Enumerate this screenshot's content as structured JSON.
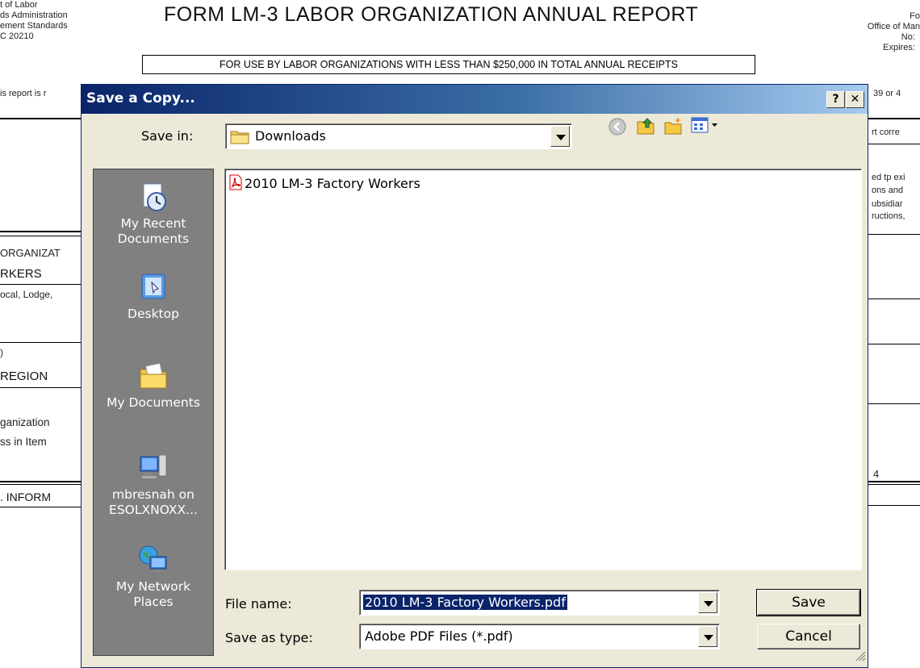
{
  "background": {
    "left_header": "t of Labor\nds Administration\nement Standards\nC 20210",
    "title": "FORM LM-3 LABOR ORGANIZATION ANNUAL REPORT",
    "subtitle": "FOR USE BY LABOR ORGANIZATIONS WITH LESS THAN $250,000 IN TOTAL ANNUAL RECEIPTS",
    "right_header": "Fo\nOffice of Man\nNo:  \nExpires:  ",
    "left_note": "is report is r",
    "right_note": "39 or 4",
    "left_fragments": [
      "ORGANIZAT",
      "RKERS",
      "ocal, Lodge,",
      ")",
      "REGION",
      "ganization",
      "ss in Item",
      ". INFORM"
    ],
    "right_fragments": [
      "rt corre",
      "ed tp exi",
      "ons and",
      "ubsidiar",
      "ructions,",
      "4"
    ]
  },
  "dialog": {
    "title": "Save a Copy...",
    "help_label": "?",
    "close_label": "✕",
    "save_in_label": "Save in:",
    "save_in_value": "Downloads",
    "places": [
      {
        "label": "My Recent\nDocuments",
        "icon": "recent-documents-icon"
      },
      {
        "label": "Desktop",
        "icon": "desktop-icon"
      },
      {
        "label": "My Documents",
        "icon": "my-documents-icon"
      },
      {
        "label": "mbresnah on\nESOLXNOXX...",
        "icon": "network-drive-icon"
      },
      {
        "label": "My Network\nPlaces",
        "icon": "network-places-icon"
      }
    ],
    "files": [
      {
        "name": "2010 LM-3 Factory Workers",
        "icon": "pdf-icon"
      }
    ],
    "file_name_label": "File name:",
    "file_name_value": "2010 LM-3 Factory Workers.pdf",
    "save_type_label": "Save as type:",
    "save_type_value": "Adobe PDF Files (*.pdf)",
    "save_button": "Save",
    "cancel_button": "Cancel"
  }
}
